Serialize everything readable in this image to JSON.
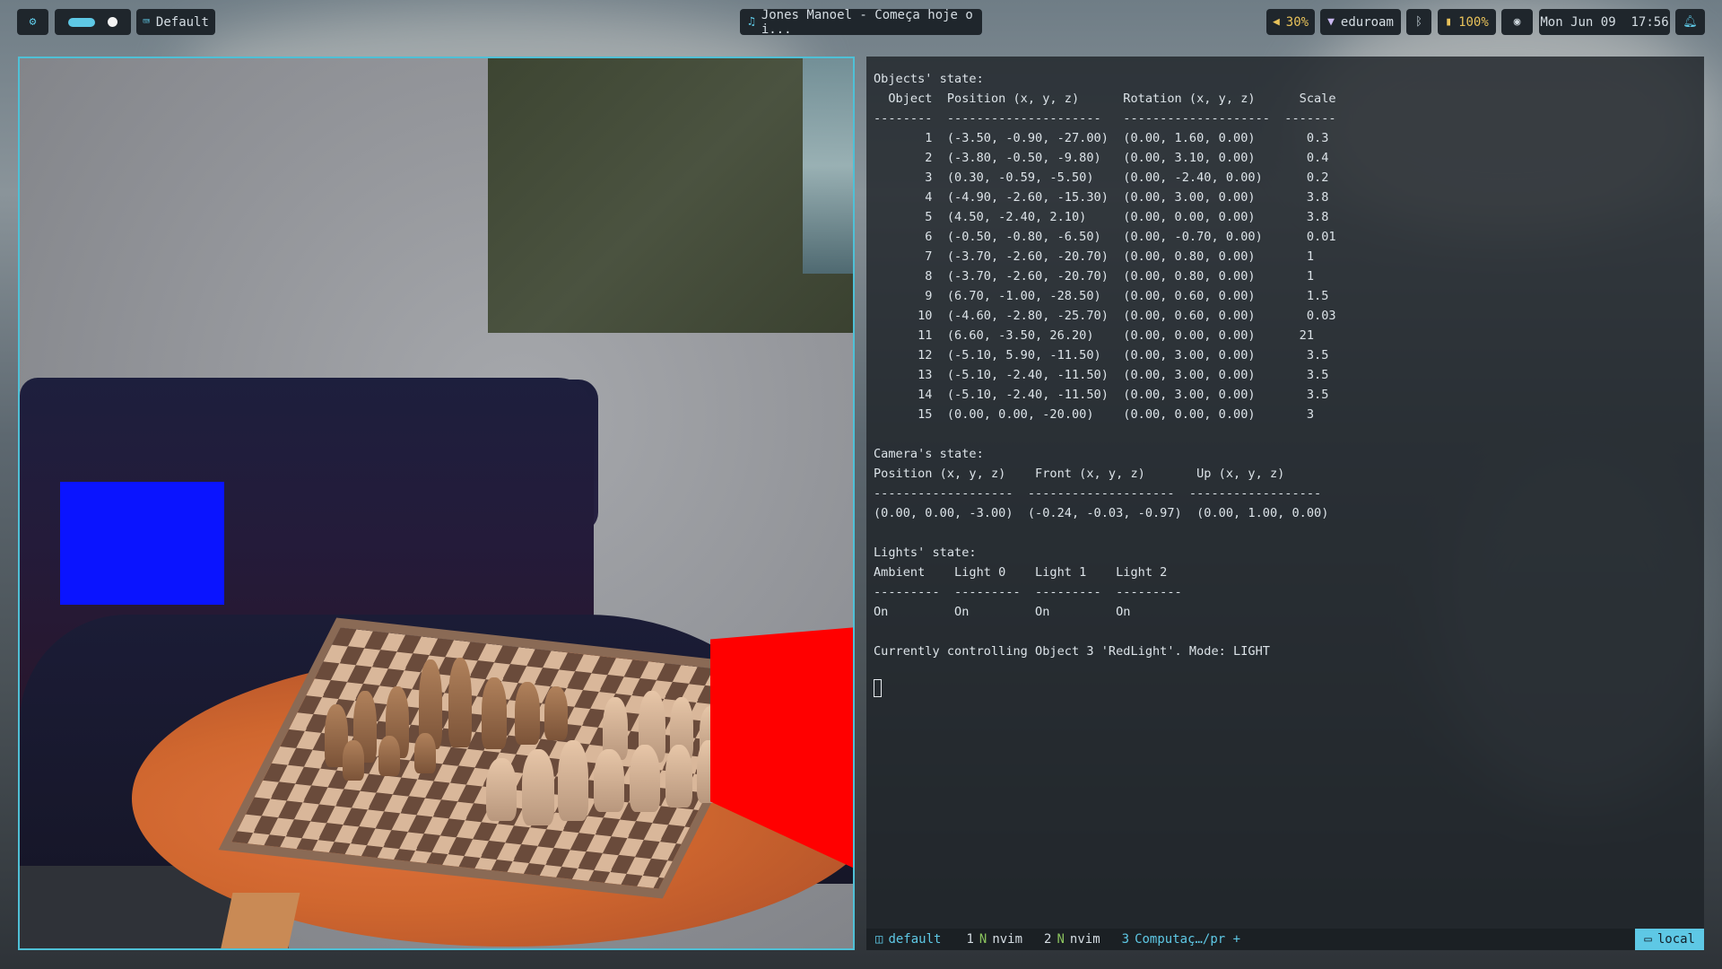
{
  "topbar": {
    "left": {
      "settings_icon": "gear-icon",
      "layout_label": "Default",
      "layout_icon": "keyboard-icon"
    },
    "media": {
      "icon": "music-note-icon",
      "title": "Jones Manoel - Começa hoje o i..."
    },
    "right": {
      "volume_icon": "speaker-icon",
      "volume": "30%",
      "wifi_icon": "wifi-icon",
      "network": "eduroam",
      "bluetooth_icon": "bluetooth-icon",
      "battery_icon": "battery-icon",
      "battery": "100%",
      "eye_icon": "eye-icon",
      "datetime": "Mon Jun 09  17:56",
      "bell_icon": "bell-icon"
    }
  },
  "terminal": {
    "text": "Objects' state:\n  Object  Position (x, y, z)      Rotation (x, y, z)      Scale\n--------  ---------------------   --------------------  -------\n       1  (-3.50, -0.90, -27.00)  (0.00, 1.60, 0.00)       0.3\n       2  (-3.80, -0.50, -9.80)   (0.00, 3.10, 0.00)       0.4\n       3  (0.30, -0.59, -5.50)    (0.00, -2.40, 0.00)      0.2\n       4  (-4.90, -2.60, -15.30)  (0.00, 3.00, 0.00)       3.8\n       5  (4.50, -2.40, 2.10)     (0.00, 0.00, 0.00)       3.8\n       6  (-0.50, -0.80, -6.50)   (0.00, -0.70, 0.00)      0.01\n       7  (-3.70, -2.60, -20.70)  (0.00, 0.80, 0.00)       1\n       8  (-3.70, -2.60, -20.70)  (0.00, 0.80, 0.00)       1\n       9  (6.70, -1.00, -28.50)   (0.00, 0.60, 0.00)       1.5\n      10  (-4.60, -2.80, -25.70)  (0.00, 0.60, 0.00)       0.03\n      11  (6.60, -3.50, 26.20)    (0.00, 0.00, 0.00)      21\n      12  (-5.10, 5.90, -11.50)   (0.00, 3.00, 0.00)       3.5\n      13  (-5.10, -2.40, -11.50)  (0.00, 3.00, 0.00)       3.5\n      14  (-5.10, -2.40, -11.50)  (0.00, 3.00, 0.00)       3.5\n      15  (0.00, 0.00, -20.00)    (0.00, 0.00, 0.00)       3\n\nCamera's state:\nPosition (x, y, z)    Front (x, y, z)       Up (x, y, z)\n-------------------  --------------------  ------------------\n(0.00, 0.00, -3.00)  (-0.24, -0.03, -0.97)  (0.00, 1.00, 0.00)\n\nLights' state:\nAmbient    Light 0    Light 1    Light 2\n---------  ---------  ---------  ---------\nOn         On         On         On\n\nCurrently controlling Object 3 'RedLight'. Mode: LIGHT"
  },
  "tmux": {
    "session_icon": "layout-icon",
    "session": "default",
    "windows": [
      {
        "index": "1",
        "icon": "neovim-icon",
        "label": "nvim"
      },
      {
        "index": "2",
        "icon": "neovim-icon",
        "label": "nvim"
      },
      {
        "index": "3",
        "label": "Computaç…/pr +"
      }
    ],
    "host_icon": "monitor-icon",
    "host": "local"
  },
  "colors": {
    "accent": "#5ec8e5",
    "blue_cube": "#0a14ff",
    "red_cube": "#ff0000"
  }
}
